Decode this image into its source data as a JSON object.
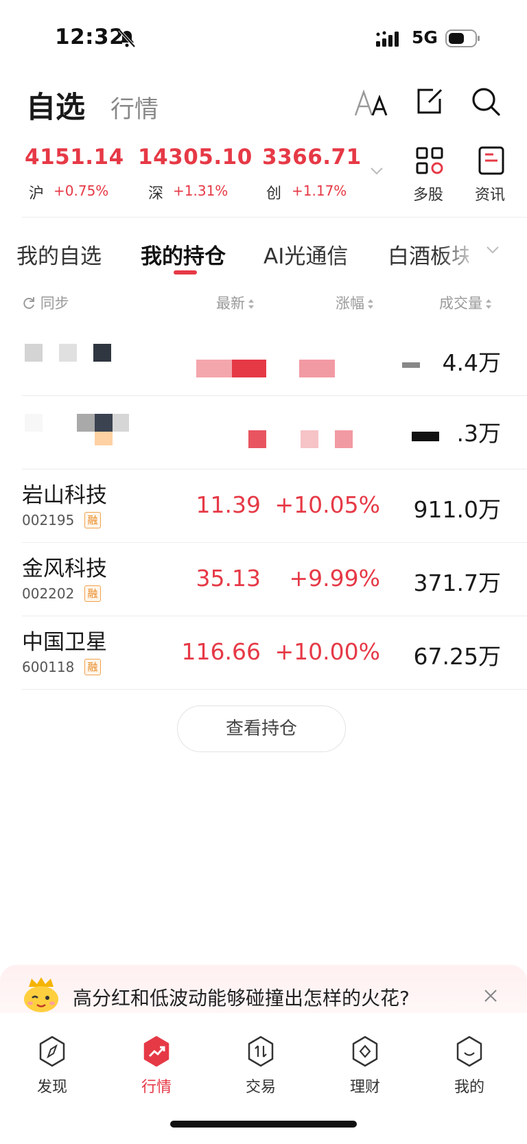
{
  "status_bar": {
    "time": "12:32",
    "network": "5G"
  },
  "header": {
    "active_tab": "自选",
    "inactive_tab": "行情"
  },
  "indices": [
    {
      "value": "4151.14",
      "name": "沪",
      "change": "+0.75%"
    },
    {
      "value": "14305.10",
      "name": "深",
      "change": "+1.31%"
    },
    {
      "value": "3366.71",
      "name": "创",
      "change": "+1.17%"
    }
  ],
  "tools": [
    {
      "label": "多股"
    },
    {
      "label": "资讯"
    }
  ],
  "tabs": [
    "我的自选",
    "我的持仓",
    "AI光通信",
    "白酒板块"
  ],
  "columns": {
    "sync": "同步",
    "latest": "最新",
    "change": "涨幅",
    "volume": "成交量"
  },
  "rows": [
    {
      "name": "岩山科技",
      "code": "002195",
      "tag": "融",
      "price": "11.39",
      "change": "+10.05%",
      "volume": "911.0万"
    },
    {
      "name": "金风科技",
      "code": "002202",
      "tag": "融",
      "price": "35.13",
      "change": "+9.99%",
      "volume": "371.7万"
    },
    {
      "name": "中国卫星",
      "code": "600118",
      "tag": "融",
      "price": "116.66",
      "change": "+10.00%",
      "volume": "67.25万"
    }
  ],
  "obscured_rows": [
    {
      "volume_partial": "4.4万"
    },
    {
      "volume_partial": ".3万"
    }
  ],
  "view_button": "查看持仓",
  "banner": {
    "text": "高分红和低波动能够碰撞出怎样的火花?"
  },
  "nav": [
    {
      "label": "发现",
      "icon": "compass-icon"
    },
    {
      "label": "行情",
      "icon": "market-icon"
    },
    {
      "label": "交易",
      "icon": "trade-icon"
    },
    {
      "label": "理财",
      "icon": "wealth-icon"
    },
    {
      "label": "我的",
      "icon": "profile-icon"
    }
  ],
  "colors": {
    "up_red": "#e63946",
    "tag_orange": "#e8871f"
  }
}
